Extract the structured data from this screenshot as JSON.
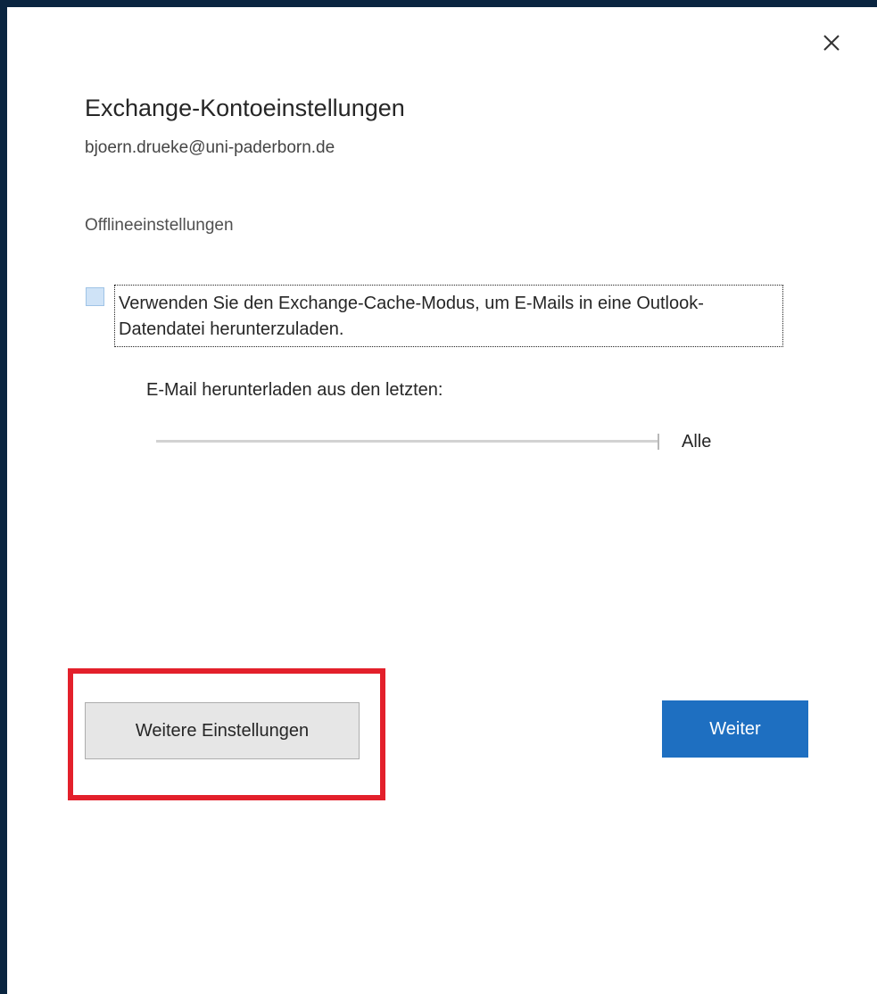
{
  "dialog": {
    "title": "Exchange-Kontoeinstellungen",
    "account_email": "bjoern.drueke@uni-paderborn.de",
    "close_icon": "close-icon"
  },
  "offline": {
    "section_label": "Offlineeinstellungen",
    "cached_mode_checkbox": {
      "label": "Verwenden Sie den Exchange-Cache-Modus, um E-Mails in eine Outlook-Datendatei herunterzuladen.",
      "checked": false
    },
    "download_slider": {
      "label": "E-Mail herunterladen aus den letzten:",
      "value_label": "Alle",
      "position_fraction": 1.0
    }
  },
  "buttons": {
    "more_settings_label": "Weitere Einstellungen",
    "next_label": "Weiter"
  },
  "colors": {
    "frame": "#0a2540",
    "primary_button": "#1e6fc1",
    "highlight": "#e3202b",
    "checkbox_fill": "#cfe3f7"
  }
}
